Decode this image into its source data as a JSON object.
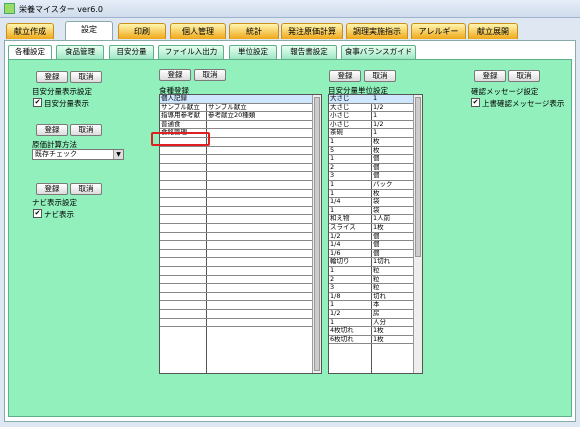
{
  "window": {
    "title": "栄養マイスター ver6.0"
  },
  "main_tabs": [
    {
      "label": "献立作成"
    },
    {
      "label": "設定"
    },
    {
      "label": "印刷"
    },
    {
      "label": "個人管理"
    },
    {
      "label": "統計"
    },
    {
      "label": "発注原価計算"
    },
    {
      "label": "調理実施指示"
    },
    {
      "label": "アレルギー"
    },
    {
      "label": "献立展開"
    }
  ],
  "sub_tabs": [
    {
      "label": "各種設定"
    },
    {
      "label": "食品管理"
    },
    {
      "label": "目安分量"
    },
    {
      "label": "ファイル入出力"
    },
    {
      "label": "単位設定"
    },
    {
      "label": "報告書設定"
    },
    {
      "label": "食事バランスガイド"
    }
  ],
  "buttons": {
    "register": "登録",
    "cancel": "取消"
  },
  "left": {
    "meyasu_title": "目安分量表示設定",
    "meyasu_checkbox": "目安分量表示",
    "genka_title": "原価計算方法",
    "genka_selected": "既存チェック",
    "navi_title": "ナビ表示設定",
    "navi_checkbox": "ナビ表示"
  },
  "shokushu": {
    "title": "食種登録",
    "rows": [
      [
        "個人記録",
        ""
      ],
      [
        "サンプル献立",
        "サンプル献立"
      ],
      [
        "指導用参考献",
        "参考献立20種類"
      ],
      [
        "普通食",
        ""
      ],
      [
        "食銘管理",
        ""
      ]
    ],
    "empty_rows": 22
  },
  "tani": {
    "title": "目安分量単位設定",
    "rows": [
      [
        "大さじ",
        "1"
      ],
      [
        "大さじ",
        "1/2"
      ],
      [
        "小さじ",
        "1"
      ],
      [
        "小さじ",
        "1/2"
      ],
      [
        "茶碗",
        "1"
      ],
      [
        "1",
        "枚"
      ],
      [
        "5",
        "枚"
      ],
      [
        "1",
        "個"
      ],
      [
        "2",
        "個"
      ],
      [
        "3",
        "個"
      ],
      [
        "1",
        "パック"
      ],
      [
        "1",
        "枚"
      ],
      [
        "1/4",
        "袋"
      ],
      [
        "1",
        "袋"
      ],
      [
        "和え物",
        "1人前"
      ],
      [
        "スライス",
        "1枚"
      ],
      [
        "1/2",
        "個"
      ],
      [
        "1/4",
        "個"
      ],
      [
        "1/6",
        "個"
      ],
      [
        "輪切り",
        "1切れ"
      ],
      [
        "1",
        "粒"
      ],
      [
        "2",
        "粒"
      ],
      [
        "3",
        "粒"
      ],
      [
        "1/8",
        "切れ"
      ],
      [
        "1",
        "本"
      ],
      [
        "1/2",
        "房"
      ],
      [
        "1",
        "人分"
      ],
      [
        "4枚切れ",
        "1枚"
      ],
      [
        "6枚切れ",
        "1枚"
      ]
    ]
  },
  "kakunin": {
    "title": "確認メッセージ設定",
    "checkbox": "上書確認メッセージ表示"
  }
}
